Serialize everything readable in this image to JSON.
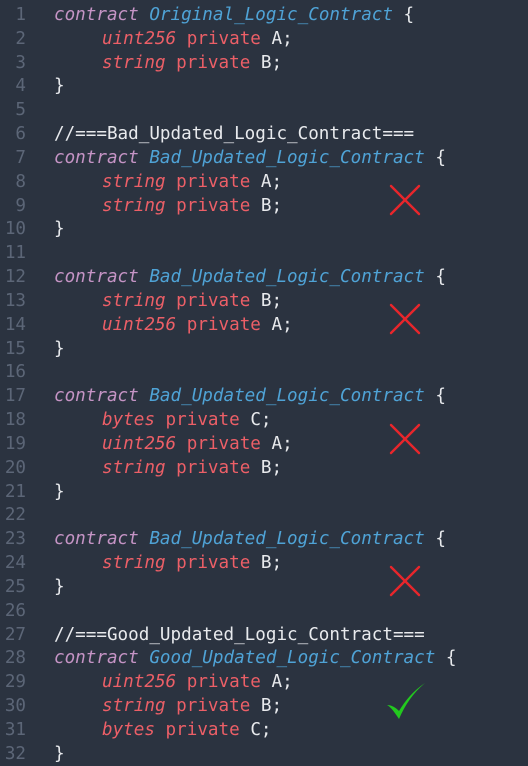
{
  "lines": [
    {
      "n": "1",
      "kind": "contract",
      "kw": "contract",
      "name": "Original_Logic_Contract",
      "brace": " {"
    },
    {
      "n": "2",
      "kind": "field",
      "type": "uint256",
      "mod": " private ",
      "var": "A;"
    },
    {
      "n": "3",
      "kind": "field",
      "type": "string",
      "mod": " private ",
      "var": "B;"
    },
    {
      "n": "4",
      "kind": "close",
      "text": "}"
    },
    {
      "n": "5",
      "kind": "blank"
    },
    {
      "n": "6",
      "kind": "comment",
      "text": "//===Bad_Updated_Logic_Contract==="
    },
    {
      "n": "7",
      "kind": "contract",
      "kw": "contract",
      "name": "Bad_Updated_Logic_Contract",
      "brace": " {"
    },
    {
      "n": "8",
      "kind": "field",
      "type": "string",
      "mod": " private ",
      "var": "A;"
    },
    {
      "n": "9",
      "kind": "field",
      "type": "string",
      "mod": " private ",
      "var": "B;"
    },
    {
      "n": "10",
      "kind": "close",
      "text": "}"
    },
    {
      "n": "11",
      "kind": "blank"
    },
    {
      "n": "12",
      "kind": "contract",
      "kw": "contract",
      "name": "Bad_Updated_Logic_Contract",
      "brace": " {"
    },
    {
      "n": "13",
      "kind": "field",
      "type": "string",
      "mod": " private ",
      "var": "B;"
    },
    {
      "n": "14",
      "kind": "field",
      "type": "uint256",
      "mod": " private ",
      "var": "A;"
    },
    {
      "n": "15",
      "kind": "close",
      "text": "}"
    },
    {
      "n": "16",
      "kind": "blank"
    },
    {
      "n": "17",
      "kind": "contract",
      "kw": "contract",
      "name": "Bad_Updated_Logic_Contract",
      "brace": " {"
    },
    {
      "n": "18",
      "kind": "field",
      "type": "bytes",
      "mod": " private ",
      "var": "C;"
    },
    {
      "n": "19",
      "kind": "field",
      "type": "uint256",
      "mod": " private ",
      "var": "A;"
    },
    {
      "n": "20",
      "kind": "field",
      "type": "string",
      "mod": " private ",
      "var": "B;"
    },
    {
      "n": "21",
      "kind": "close",
      "text": "}"
    },
    {
      "n": "22",
      "kind": "blank"
    },
    {
      "n": "23",
      "kind": "contract",
      "kw": "contract",
      "name": "Bad_Updated_Logic_Contract",
      "brace": " {"
    },
    {
      "n": "24",
      "kind": "field",
      "type": "string",
      "mod": " private ",
      "var": "B;"
    },
    {
      "n": "25",
      "kind": "close",
      "text": "}"
    },
    {
      "n": "26",
      "kind": "blank"
    },
    {
      "n": "27",
      "kind": "comment",
      "text": "//===Good_Updated_Logic_Contract==="
    },
    {
      "n": "28",
      "kind": "contract",
      "kw": "contract",
      "name": "Good_Updated_Logic_Contract",
      "brace": " {"
    },
    {
      "n": "29",
      "kind": "field",
      "type": "uint256",
      "mod": " private ",
      "var": "A;"
    },
    {
      "n": "30",
      "kind": "field",
      "type": "string",
      "mod": " private ",
      "var": "B;"
    },
    {
      "n": "31",
      "kind": "field",
      "type": "bytes",
      "mod": " private ",
      "var": "C;"
    },
    {
      "n": "32",
      "kind": "close",
      "text": "}"
    }
  ],
  "marks": [
    {
      "icon": "cross-icon",
      "line": 9,
      "verdict": "invalid"
    },
    {
      "icon": "cross-icon",
      "line": 14,
      "verdict": "invalid"
    },
    {
      "icon": "cross-icon",
      "line": 19,
      "verdict": "invalid"
    },
    {
      "icon": "cross-icon",
      "line": 25,
      "verdict": "invalid"
    },
    {
      "icon": "check-icon",
      "line": 30,
      "verdict": "valid"
    }
  ],
  "colors": {
    "background": "#2b3340",
    "gutter": "#5c6677",
    "keyword": "#c594c5",
    "contract_name": "#4fa3d6",
    "type": "#ec5f67",
    "text": "#e8eaed",
    "cross": "#e8262b",
    "check": "#22c91e"
  }
}
